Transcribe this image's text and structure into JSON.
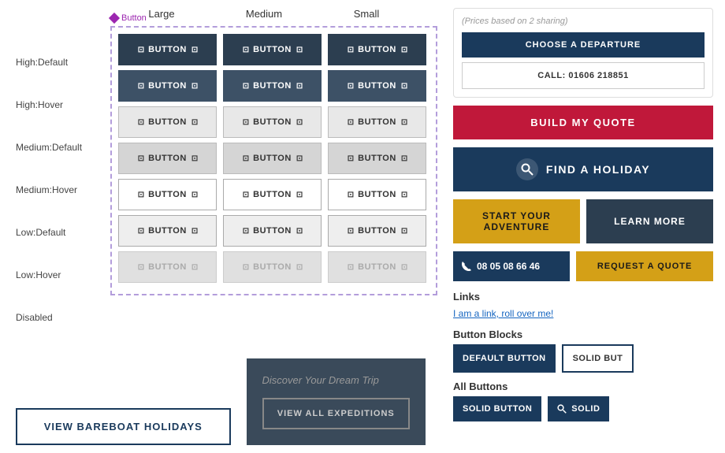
{
  "columns": {
    "large": "Large",
    "medium": "Medium",
    "small": "Small"
  },
  "rows": [
    {
      "label": "High:Default"
    },
    {
      "label": "High:Hover"
    },
    {
      "label": "Medium:Default"
    },
    {
      "label": "Medium:Hover"
    },
    {
      "label": "Low:Default"
    },
    {
      "label": "Low:Hover"
    },
    {
      "label": "Disabled"
    }
  ],
  "button_label": "BUTTON",
  "button_tag": "Button",
  "right": {
    "departure_title": "(Prices based on 2 sharing)",
    "choose_departure": "CHOOSE A DEPARTURE",
    "call_label": "CALL: 01606 218851",
    "build_quote": "BUILD MY QUOTE",
    "find_holiday": "FIND A HOLIDAY",
    "start_adventure": "START YOUR ADVENTURE",
    "learn_more": "LEARN MORE",
    "phone_number": "08 05 08 66 46",
    "request_quote": "REQUEST A QUOTE",
    "links_title": "Links",
    "link_text": "I am a link, roll over me!",
    "button_blocks_title": "Button Blocks",
    "default_button": "DEFAULT BUTTON",
    "solid_button": "SOLID BUT",
    "all_buttons_title": "All Buttons",
    "solid_btn_label": "SOLID BUTTON",
    "solid_search_label": "SOLID"
  },
  "bottom": {
    "view_bareboat": "VIEW BAREBOAT HOLIDAYS",
    "discover_title": "Discover Your Dream Trip",
    "view_expeditions": "VIEW ALL EXPEDITIONS"
  }
}
